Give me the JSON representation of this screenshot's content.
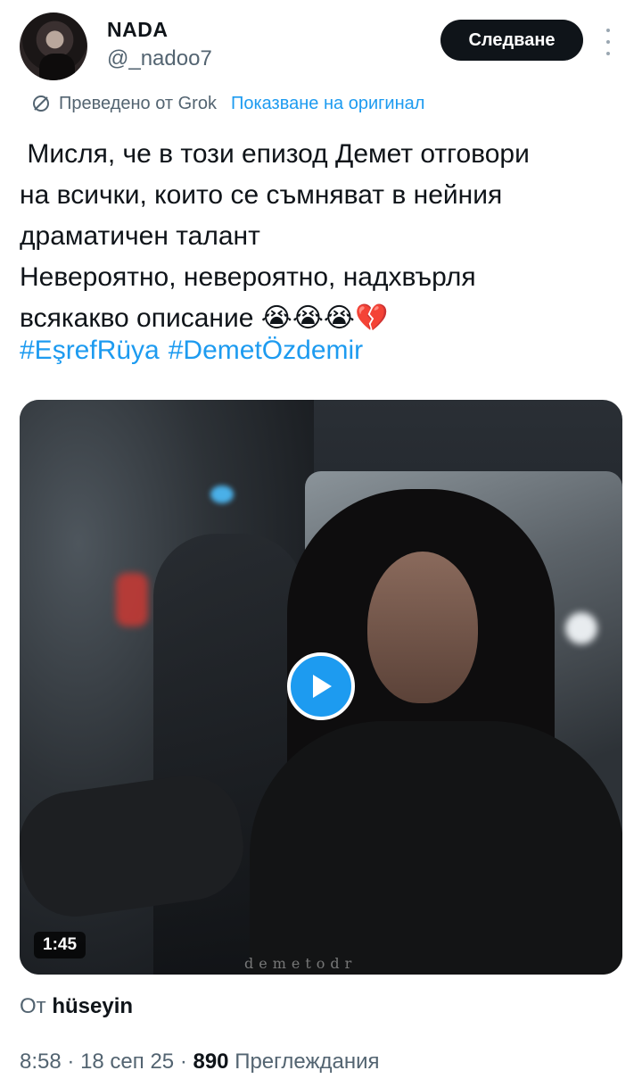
{
  "author": {
    "name": "NADA",
    "handle": "@_nadoo7"
  },
  "follow_label": "Следване",
  "translation": {
    "label": "Преведено от Grok",
    "show_original": "Показване на оригинал"
  },
  "tweet": {
    "text": " Мисля, че в този епизод Демет отговори\nна всички, които се съмняват в нейния\nдраматичен талант\nНевероятно, невероятно, надхвърля\nвсякакво описание 😭😭😭💔",
    "hashtags": [
      "#EşrefRüya",
      "#DemetÖzdemir"
    ]
  },
  "media": {
    "duration": "1:45",
    "watermark": "demetodr"
  },
  "attribution": {
    "prefix": "От",
    "user": "hüseyin"
  },
  "meta": {
    "time": "8:58",
    "date": "18 сеп 25",
    "views": "890",
    "views_label": "Преглеждания",
    "sep": "·"
  },
  "colors": {
    "link": "#1d9bf0",
    "text": "#0f1419",
    "muted": "#536471"
  }
}
